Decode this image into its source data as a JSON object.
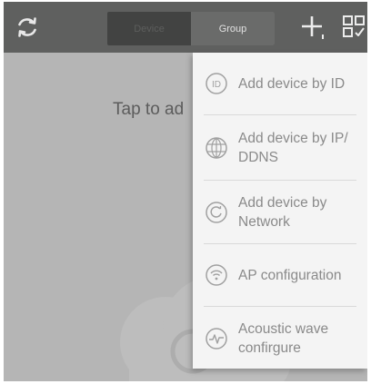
{
  "topbar": {
    "tabs": [
      {
        "label": "Device",
        "active": false
      },
      {
        "label": "Group",
        "active": true
      }
    ],
    "refresh_icon": "refresh-icon",
    "add_icon": "plus-icon",
    "scan_icon": "qr-scan-icon"
  },
  "main": {
    "empty_text": "Tap to ad"
  },
  "menu": {
    "items": [
      {
        "label": "Add device by ID",
        "icon": "id-icon"
      },
      {
        "label": "Add device by IP/ DDNS",
        "icon": "globe-icon"
      },
      {
        "label": "Add device by Network",
        "icon": "network-search-icon"
      },
      {
        "label": "AP configuration",
        "icon": "wifi-icon"
      },
      {
        "label": "Acoustic wave confirgure",
        "icon": "sound-wave-icon"
      }
    ]
  },
  "colors": {
    "topbar": "#5f605f",
    "background": "#b5b5b5",
    "menu_background": "#f4f4f4",
    "menu_text": "#8a8a8a"
  }
}
